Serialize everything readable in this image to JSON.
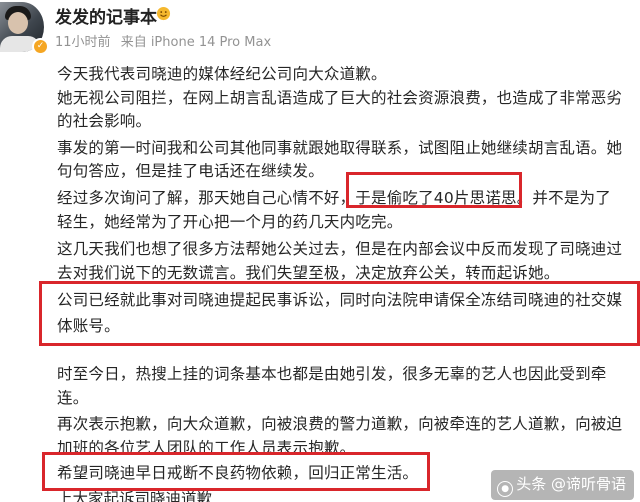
{
  "header": {
    "username": "发发的记事本",
    "time": "11小时前",
    "source": "来自 iPhone 14 Pro Max",
    "avatar_icon": "user-avatar",
    "vip_icon": "smile-badge-icon"
  },
  "post": {
    "lines": [
      "今天我代表司晓迪的媒体经纪公司向大众道歉。",
      "她无视公司阻拦，在网上胡言乱语造成了巨大的社会资源浪费，也造成了非常恶劣",
      "的社会影响。",
      "事发的第一时间我和公司其他同事就跟她取得联系，试图阻止她继续胡言乱语。她",
      "句句答应，但是挂了电话还在继续发。",
      "经过多次询问了解，那天她自己心情不好，于是偷吃了40片思诺思。并不是为了",
      "轻生，她经常为了开心把一个月的药几天内吃完。",
      "这几天我们也想了很多方法帮她公关过去，但是在内部会议中反而发现了司晓迪过",
      "去对我们说下的无数谎言。我们失望至极，决定放弃公关，转而起诉她。",
      "公司已经就此事对司晓迪提起民事诉讼，同时向法院申请保全冻结司晓迪的社交媒",
      "体账号。",
      "时至今日，热搜上挂的词条基本也都是由她引发，很多无辜的艺人也因此受到牵",
      "连。",
      "再次表示抱歉，向大众道歉，向被浪费的警力道歉，向被牵连的艺人道歉，向被迫",
      "加班的各位艺人团队的工作人员表示抱歉。",
      "希望司晓迪早日戒断不良药物依赖，回归正常生活。"
    ],
    "clipped_line": "上大家起诉司晓迪道歉"
  },
  "watermark": {
    "text": "头条 @谛听骨语"
  },
  "colors": {
    "highlight_box": "#d9262b",
    "meta_text": "#939393"
  }
}
